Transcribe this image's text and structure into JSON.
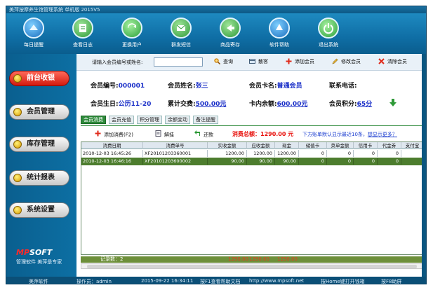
{
  "titlebar": {
    "text": "美萍按摩养生馆管理系统 单机版    2015V5"
  },
  "toolbar": {
    "items": [
      {
        "label": "每日提醒",
        "icon": "calendar-icon"
      },
      {
        "label": "查看日志",
        "icon": "log-icon"
      },
      {
        "label": "更换用户",
        "icon": "switch-user-icon"
      },
      {
        "label": "群发短信",
        "icon": "sms-icon"
      },
      {
        "label": "商品寄存",
        "icon": "storage-icon"
      },
      {
        "label": "软件帮助",
        "icon": "help-icon"
      },
      {
        "label": "退出系统",
        "icon": "power-icon"
      }
    ]
  },
  "sidebar": {
    "items": [
      {
        "label": "前台收银",
        "active": true
      },
      {
        "label": "会员管理",
        "active": false
      },
      {
        "label": "库存管理",
        "active": false
      },
      {
        "label": "统计报表",
        "active": false
      },
      {
        "label": "系统设置",
        "active": false
      }
    ],
    "logo": {
      "brand_red": "MP",
      "brand_white": "SOFT",
      "slogan": "管理软件  美萍是专家"
    }
  },
  "search": {
    "label": "请输入会员编号或姓名:",
    "value": "",
    "placeholder": "",
    "buttons": {
      "query": "查询",
      "scan": "散客",
      "add": "添加会员",
      "edit": "修改会员",
      "clear": "清除会员"
    }
  },
  "member": {
    "id_label": "会员编号:",
    "id": "000001",
    "name_label": "会员姓名:",
    "name": "张三",
    "card_label": "会员卡名:",
    "card": "普通会员",
    "phone_label": "联系电话:",
    "phone": "",
    "birthday_label": "会员生日:",
    "birthday": "公历11-20",
    "spent_label": "累计交费:",
    "spent": "500.00元",
    "balance_label": "卡内余额:",
    "balance": "600.00元",
    "points_label": "会员积分:",
    "points": "65分"
  },
  "tabs": [
    {
      "label": "会员消费",
      "active": true
    },
    {
      "label": "会员充值",
      "active": false
    },
    {
      "label": "积分管理",
      "active": false
    },
    {
      "label": "余额变动",
      "active": false
    },
    {
      "label": "备注提醒",
      "active": false
    }
  ],
  "actions": {
    "add_consume": "添加消费(F2)",
    "settle": "解挂",
    "refund": "还款",
    "total": "消费总额：1290.00 元",
    "hint": "下方账单默认显示最近10条，",
    "hint_link": "想显示更多？"
  },
  "table": {
    "columns": [
      "消费日期",
      "消费单号",
      "实收金额",
      "应收金额",
      "现金",
      "储值卡",
      "菜单金额",
      "信用卡",
      "代金券",
      "支付宝"
    ],
    "rows": [
      [
        "2010-12-03 16:45:26",
        "XF20101203360001",
        "1200.00",
        "1200.00",
        "1200.00",
        "0",
        "0",
        "0",
        "0",
        ""
      ],
      [
        "2010-12-03 16:46:16",
        "XF20101203600002",
        "90.00",
        "90.00",
        "90.00",
        "0",
        "0",
        "0",
        "0",
        ""
      ]
    ],
    "footer": {
      "records": "记录数：2",
      "sum_real": "1290.00",
      "sum_due": "1290.00",
      "sum_cash": "1290.00"
    }
  },
  "status": {
    "app": "美萍软件",
    "operator": "操作员：admin",
    "datetime": "2015-09-22 16:34:11",
    "help": "按F1查看帮助文档",
    "website": "http://www.mpsoft.net",
    "home_key": "按Home键打开钱箱",
    "f8": "按F8助屏"
  },
  "colors": {
    "frame": "#0b5d8a",
    "accent_green": "#2f8a3c",
    "total_red": "#e8110c",
    "link_blue": "#1a2fc8"
  }
}
